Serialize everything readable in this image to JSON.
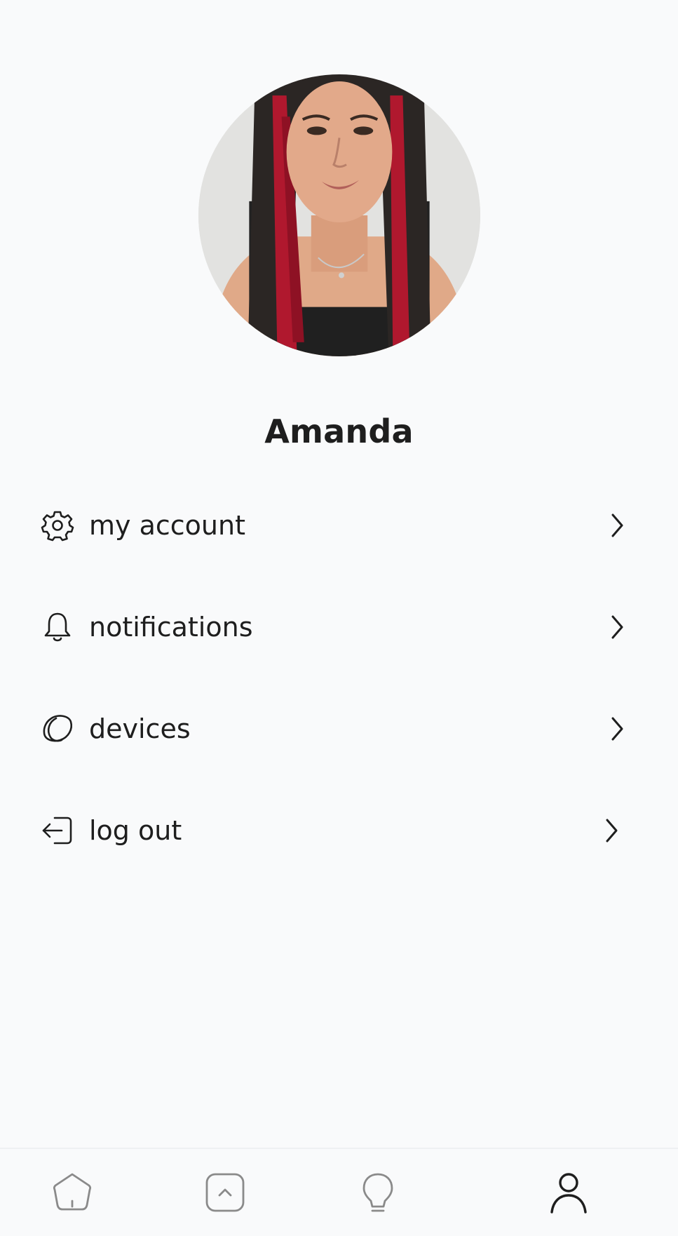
{
  "profile": {
    "name": "Amanda"
  },
  "menu": {
    "items": [
      {
        "label": "my account",
        "icon": "gear-icon"
      },
      {
        "label": "notifications",
        "icon": "bell-icon"
      },
      {
        "label": "devices",
        "icon": "devices-icon"
      },
      {
        "label": "log out",
        "icon": "logout-icon"
      }
    ]
  },
  "bottom_nav": {
    "items": [
      {
        "icon": "home-icon",
        "active": false
      },
      {
        "icon": "scenes-icon",
        "active": false
      },
      {
        "icon": "lightbulb-icon",
        "active": false
      },
      {
        "icon": "profile-icon",
        "active": true
      }
    ]
  },
  "colors": {
    "background": "#f9fafb",
    "text": "#1e1e1e",
    "inactive_icon": "#8a8a8a",
    "active_icon": "#1e1e1e"
  }
}
